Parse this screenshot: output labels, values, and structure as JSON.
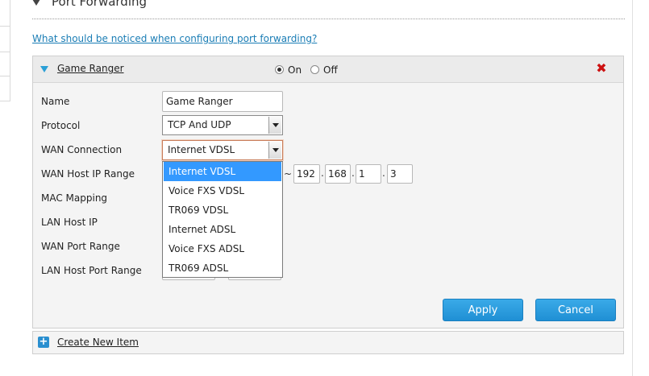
{
  "section": {
    "title": "Port Forwarding"
  },
  "notice_link": "What should be noticed when configuring port forwarding?",
  "item": {
    "name": "Game Ranger",
    "on_label": "On",
    "off_label": "Off",
    "state": "On"
  },
  "form": {
    "labels": {
      "name": "Name",
      "protocol": "Protocol",
      "wan_connection": "WAN Connection",
      "wan_host_ip_range": "WAN Host IP Range",
      "mac_mapping": "MAC Mapping",
      "lan_host_ip": "LAN Host IP",
      "wan_port_range": "WAN Port Range",
      "lan_host_port_range": "LAN Host Port Range"
    },
    "name_value": "Game Ranger",
    "protocol_value": "TCP And UDP",
    "wan_connection_value": "Internet VDSL",
    "range_separator": "~",
    "wan_host_ip_end": [
      "192",
      "168",
      "1",
      "3"
    ]
  },
  "dropdown": {
    "options": [
      "Internet VDSL",
      "Voice FXS VDSL",
      "TR069 VDSL",
      "Internet ADSL",
      "Voice FXS ADSL",
      "TR069 ADSL"
    ],
    "selected_index": 0
  },
  "buttons": {
    "apply": "Apply",
    "cancel": "Cancel"
  },
  "create_new": "Create New Item",
  "colors": {
    "accent": "#2a9fd6",
    "link": "#1a7db5",
    "delete": "#cc1111",
    "highlight": "#3399ff"
  }
}
